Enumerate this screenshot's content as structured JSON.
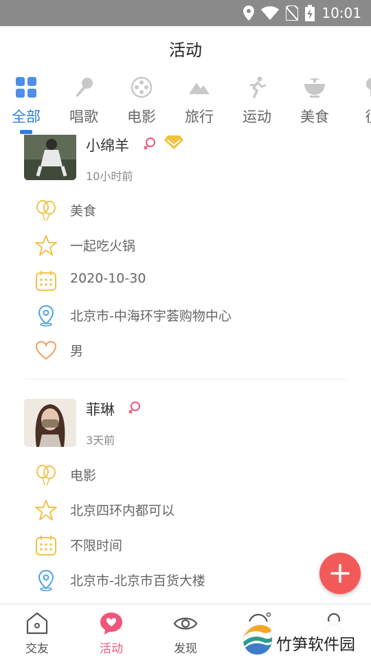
{
  "status_bar": {
    "time": "10:01",
    "icons": [
      "location-icon",
      "wifi-icon",
      "no-sim-icon",
      "battery-charging-icon"
    ]
  },
  "header": {
    "title": "活动"
  },
  "tabs": [
    {
      "label": "全部",
      "icon": "grid-icon",
      "active": true
    },
    {
      "label": "唱歌",
      "icon": "microphone-icon",
      "active": false
    },
    {
      "label": "电影",
      "icon": "film-reel-icon",
      "active": false
    },
    {
      "label": "旅行",
      "icon": "mountain-icon",
      "active": false
    },
    {
      "label": "运动",
      "icon": "runner-icon",
      "active": false
    },
    {
      "label": "美食",
      "icon": "food-bowl-icon",
      "active": false
    },
    {
      "label": "征",
      "icon": "more-icon",
      "active": false
    }
  ],
  "colors": {
    "accent_blue": "#2f7de1",
    "accent_pink": "#f0567a",
    "fab_red": "#f25a5a",
    "icon_yellow": "#f1c24a",
    "icon_blue": "#4aa3e6",
    "icon_orange": "#f2a05a",
    "vip_gold": "#f3c33f"
  },
  "feed": {
    "posts": [
      {
        "username": "小绵羊",
        "gender_icon": "female-icon",
        "badge_icon": "diamond-vip-icon",
        "time": "10小时前",
        "category": "美食",
        "activity": "一起吃火锅",
        "date": "2020-10-30",
        "location": "北京市-中海环宇荟购物中心",
        "gender": "男"
      },
      {
        "username": "菲琳",
        "gender_icon": "female-icon",
        "time": "3天前",
        "category": "电影",
        "activity": "北京四环内都可以",
        "date": "不限时间",
        "location": "北京市-北京市百货大楼"
      }
    ]
  },
  "fab": {
    "icon": "plus-icon"
  },
  "bottom_nav": [
    {
      "label": "交友",
      "icon": "home-icon",
      "active": false
    },
    {
      "label": "活动",
      "icon": "heart-bubble-icon",
      "active": true
    },
    {
      "label": "发现",
      "icon": "eye-icon",
      "active": false
    },
    {
      "label": "",
      "icon": "chat-icon",
      "active": false
    },
    {
      "label": "",
      "icon": "user-icon",
      "active": false
    }
  ],
  "watermark": {
    "text": "竹笋软件园"
  }
}
